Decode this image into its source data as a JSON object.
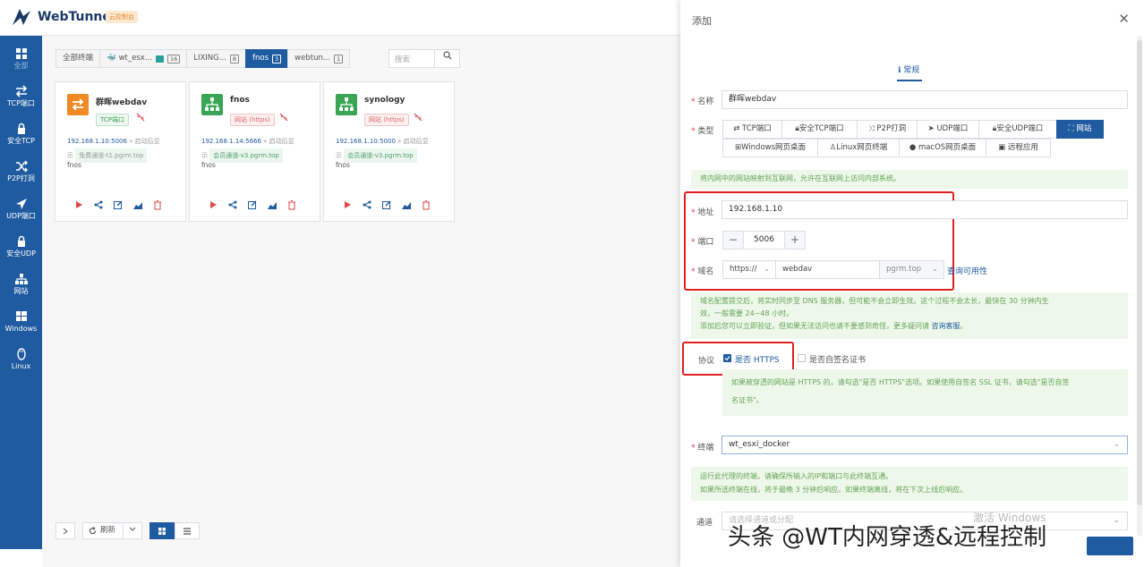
{
  "app": {
    "brand": "WebTunnel",
    "badge": "云控制台"
  },
  "sidebar": {
    "items": [
      {
        "label": "全部",
        "icon": "grid-icon"
      },
      {
        "label": "TCP端口",
        "icon": "swap-icon"
      },
      {
        "label": "安全TCP",
        "icon": "lock-icon"
      },
      {
        "label": "P2P打洞",
        "icon": "shuffle-icon"
      },
      {
        "label": "UDP端口",
        "icon": "send-icon"
      },
      {
        "label": "安全UDP",
        "icon": "lock-icon"
      },
      {
        "label": "网站",
        "icon": "sitemap-icon"
      },
      {
        "label": "Windows",
        "icon": "windows-icon"
      },
      {
        "label": "Linux",
        "icon": "linux-icon"
      }
    ]
  },
  "tabs": [
    {
      "label": "全部终端",
      "count": ""
    },
    {
      "label": "wt_esx...",
      "count": "16"
    },
    {
      "label": "LIXING...",
      "count": "8"
    },
    {
      "label": "fnos",
      "count": "3"
    },
    {
      "label": "webtun...",
      "count": "1"
    }
  ],
  "search": {
    "placeholder": "搜索"
  },
  "cards": [
    {
      "name": "群晖webdav",
      "tag": "TCP端口",
      "ip": "192.168.1.10:5006",
      "startup": "启动后显",
      "startup2": "示",
      "channel": "免费通道-t1.pgrm.top",
      "terminal": "fnos",
      "color": "#f08a24",
      "tag_color": "#3aa655"
    },
    {
      "name": "fnos",
      "tag": "网站 (https)",
      "ip": "192.168.1.14:5666",
      "startup": "启动后显",
      "startup2": "示",
      "channel": "会员通道-v3.pgrm.top",
      "terminal": "fnos",
      "color": "#3aa655",
      "tag_color": "#e06666"
    },
    {
      "name": "synology",
      "tag": "网站 (https)",
      "ip": "192.168.1.10:5000",
      "startup": "启动后显",
      "startup2": "示",
      "channel": "会员通道-v3.pgrm.top",
      "terminal": "fnos",
      "color": "#3aa655",
      "tag_color": "#e06666"
    }
  ],
  "bottom": {
    "refresh": "刷新"
  },
  "drawer": {
    "title": "添加",
    "tab": "常规",
    "name_label": "名称",
    "name_value": "群晖webdav",
    "type_label": "类型",
    "types_row1": [
      "TCP端口",
      "安全TCP端口",
      "P2P打洞",
      "UDP端口",
      "安全UDP端口",
      "网站"
    ],
    "types_row2": [
      "Windows网页桌面",
      "Linux网页终端",
      "macOS网页桌面",
      "远程应用"
    ],
    "type_note": "将内网中的网站映射到互联网，允许在互联网上访问内部系统。",
    "addr_label": "地址",
    "addr_value": "192.168.1.10",
    "port_label": "端口",
    "port_value": "5006",
    "domain_label": "域名",
    "domain_scheme": "https://",
    "domain_prefix": "webdav",
    "domain_suffix": "pgrm.top",
    "check_link": "查询可用性",
    "domain_note1": "域名配置提交后，将实时同步至 DNS 服务器，但可能不会立即生效。这个过程不会太长，最快在 30 分钟内生",
    "domain_note2": "效，一般需要 24~48 小时。",
    "domain_note3": "添加后您可以立即验证，但如果无法访问也请不要感到奇怪，更多疑问请",
    "domain_note_link": "咨询客服",
    "domain_note_end": "。",
    "proto_label": "协议",
    "https_label": "是否 HTTPS",
    "selfsign_label": "是否自签名证书",
    "https_note1": "如果被穿透的网站是 HTTPS 的，请勾选\"是否 HTTPS\"选项。如果使用自签名 SSL 证书，请勾选\"是否自签",
    "https_note2": "名证书\"。",
    "terminal_label": "终端",
    "terminal_value": "wt_esxi_docker",
    "terminal_note1": "运行此代理的终端，请确保所输入的IP和端口与此终端互通。",
    "terminal_note2": "如果所选终端在线，将于最晚 3 分钟后响应。如果终端离线，将在下次上线后响应。",
    "channel_label": "通道",
    "channel_value": "请选择通道或分配"
  },
  "overlay": {
    "activate": "激活 Windows",
    "watermark": "头条 @WT内网穿透&远程控制"
  },
  "colors": {
    "primary": "#1f5ba0",
    "danger": "#e02020",
    "note_bg": "#eef8ea",
    "note_text": "#63a355"
  }
}
